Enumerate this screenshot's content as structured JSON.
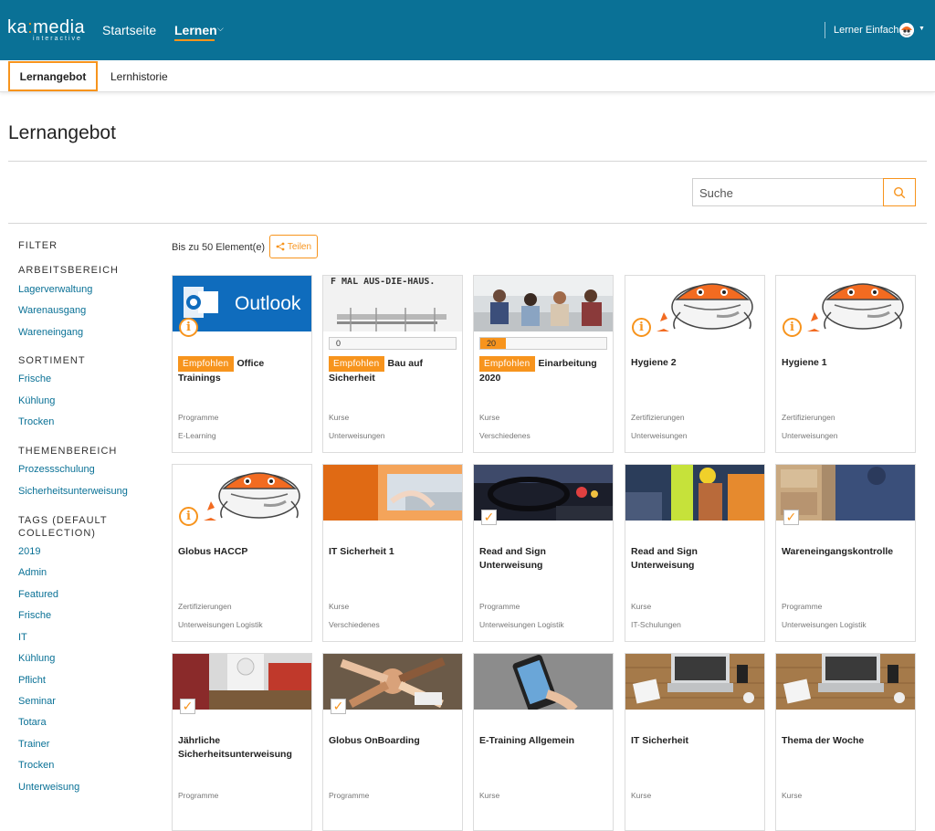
{
  "brand": {
    "logo_main": "ka",
    "logo_colon": ":",
    "logo_rest": "media",
    "logo_sub": "interactive"
  },
  "topnav": {
    "home": "Startseite",
    "learn": "Lernen",
    "user": "Lerner Einfach"
  },
  "subnav": {
    "tab_active": "Lernangebot",
    "tab_other": "Lernhistorie"
  },
  "page": {
    "title": "Lernangebot",
    "count_label": "Bis zu 50 Element(e)",
    "share_label": "Teilen"
  },
  "search": {
    "placeholder": "Suche"
  },
  "filter": {
    "title": "FILTER",
    "groups": [
      {
        "heading": "ARBEITSBEREICH",
        "items": [
          "Lagerverwaltung",
          "Warenausgang",
          "Wareneingang"
        ]
      },
      {
        "heading": "SORTIMENT",
        "items": [
          "Frische",
          "Kühlung",
          "Trocken"
        ]
      },
      {
        "heading": "THEMENBEREICH",
        "items": [
          "Prozessschulung",
          "Sicherheitsunterweisung"
        ]
      },
      {
        "heading": "TAGS (DEFAULT COLLECTION)",
        "items": [
          "2019",
          "Admin",
          "Featured",
          "Frische",
          "IT",
          "Kühlung",
          "Pflicht",
          "Seminar",
          "Totara",
          "Trainer",
          "Trocken",
          "Unterweisung"
        ]
      }
    ]
  },
  "cards": [
    {
      "badge": "Empfohlen",
      "title": "Office Trainings",
      "type": "Programme",
      "category": "E-Learning",
      "image": "outlook",
      "image_text": "Outlook",
      "marker": "info"
    },
    {
      "badge": "Empfohlen",
      "title": "Bau auf Sicherheit",
      "type": "Kurse",
      "category": "Unterweisungen",
      "image": "sign",
      "image_text": "F MAL AUS-DIE-HAUS.",
      "progress": 0,
      "progress_label": "0"
    },
    {
      "badge": "Empfohlen",
      "title": "Einarbeitung 2020",
      "type": "Kurse",
      "category": "Verschiedenes",
      "image": "office",
      "progress": 20,
      "progress_label": "20"
    },
    {
      "title": "Hygiene 2",
      "type": "Zertifizierungen",
      "category": "Unterweisungen",
      "image": "mascot",
      "marker": "info"
    },
    {
      "title": "Hygiene 1",
      "type": "Zertifizierungen",
      "category": "Unterweisungen",
      "image": "mascot",
      "marker": "info"
    },
    {
      "title": "Globus HACCP",
      "type": "Zertifizierungen",
      "category": "Unterweisungen Logistik",
      "image": "mascot",
      "marker": "info"
    },
    {
      "title": "IT Sicherheit 1",
      "type": "Kurse",
      "category": "Verschiedenes",
      "image": "laptop-orange"
    },
    {
      "title": "Read and Sign Unterweisung",
      "type": "Programme",
      "category": "Unterweisungen Logistik",
      "image": "car",
      "marker": "check"
    },
    {
      "title": "Read and Sign Unterweisung",
      "type": "Kurse",
      "category": "IT-Schulungen",
      "image": "workers"
    },
    {
      "title": "Wareneingangskontrolle",
      "type": "Programme",
      "category": "Unterweisungen Logistik",
      "image": "warehouse",
      "marker": "check"
    },
    {
      "title": "Jährliche Sicherheitsunterweisung",
      "type": "Programme",
      "category": "",
      "image": "safety",
      "marker": "check"
    },
    {
      "title": "Globus OnBoarding",
      "type": "Programme",
      "category": "",
      "image": "hands",
      "marker": "check"
    },
    {
      "title": "E-Training Allgemein",
      "type": "Kurse",
      "category": "",
      "image": "phone"
    },
    {
      "title": "IT Sicherheit",
      "type": "Kurse",
      "category": "",
      "image": "desk"
    },
    {
      "title": "Thema der Woche",
      "type": "Kurse",
      "category": "",
      "image": "desk"
    }
  ],
  "colors": {
    "header_bg": "#0a7196",
    "accent": "#f7941d",
    "link": "#0a7196"
  }
}
